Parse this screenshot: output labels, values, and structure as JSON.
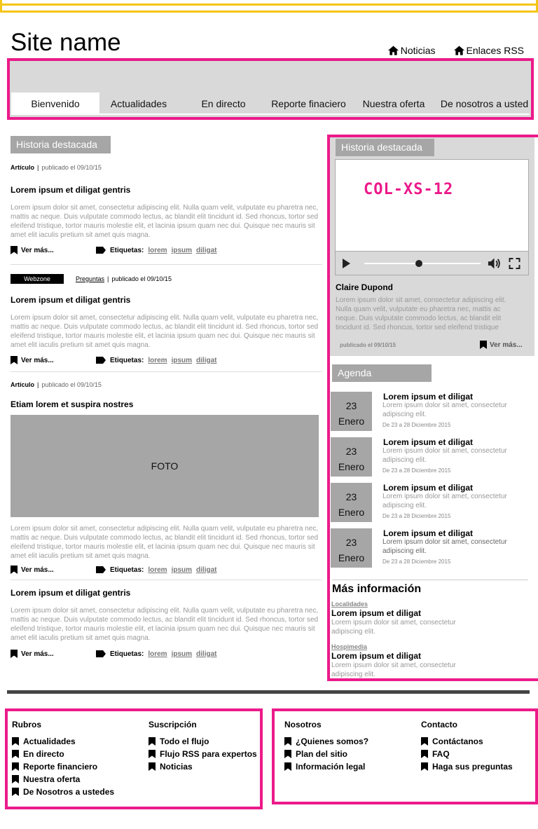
{
  "site_name": "Site name",
  "toplinks": [
    {
      "label": "Noticias",
      "icon": "home-icon"
    },
    {
      "label": "Enlaces RSS",
      "icon": "home-icon"
    }
  ],
  "tabs": [
    "Bienvenido",
    "Actualidades",
    "En directo",
    "Reporte finaciero",
    "Nuestra oferta",
    "De nosotros a usted"
  ],
  "main": {
    "section_label": "Historia destacada",
    "articles": [
      {
        "kind": "Artículo",
        "published": "publicado el 09/10/15",
        "title": "Lorem ipsum et diligat gentris",
        "text": "Lorem ipsum dolor sit amet, consectetur adipiscing elit. Nulla quam velit, vulputate eu pharetra nec, mattis ac neque. Duis vulputate commodo lectus, ac blandit elit tincidunt id. Sed rhoncus, tortor sed eleifend tristique, tortor mauris molestie elit, et lacinia ipsum quam nec dui. Quisque nec mauris sit amet elit iaculis pretium sit amet quis magna.",
        "more": "Ver más...",
        "tags_label": "Etiquetas:",
        "tags": [
          "lorem",
          "ipsum",
          "diligat"
        ]
      },
      {
        "badge": "Webzone",
        "category": "Preguntas",
        "published": "publicado el 09/10/15",
        "title": "Lorem ipsum et diligat gentris",
        "text": "Lorem ipsum dolor sit amet, consectetur adipiscing elit. Nulla quam velit, vulputate eu pharetra nec, mattis ac neque. Duis vulputate commodo lectus, ac blandit elit tincidunt id. Sed rhoncus, tortor sed eleifend tristique, tortor mauris molestie elit, et lacinia ipsum quam nec dui. Quisque nec mauris sit amet elit iaculis pretium sit amet quis magna.",
        "more": "Ver más...",
        "tags_label": "Etiquetas:",
        "tags": [
          "lorem",
          "ipsum",
          "diligat"
        ]
      },
      {
        "kind": "Artículo",
        "published": "publicado el 09/10/15",
        "title": "Etiam lorem et suspira nostres",
        "photo": "FOTO",
        "text": "Lorem ipsum dolor sit amet, consectetur adipiscing elit. Nulla quam velit, vulputate eu pharetra nec, mattis ac neque. Duis vulputate commodo lectus, ac blandit elit tincidunt id. Sed rhoncus, tortor sed eleifend tristique, tortor mauris molestie elit, et lacinia ipsum quam nec dui. Quisque nec mauris sit amet elit iaculis pretium sit amet quis magna.",
        "more": "Ver más...",
        "tags_label": "Etiquetas:",
        "tags": [
          "lorem",
          "ipsum",
          "diligat"
        ]
      },
      {
        "title": "Lorem ipsum et diligat gentris",
        "text": "Lorem ipsum dolor sit amet, consectetur adipiscing elit. Nulla quam velit, vulputate eu pharetra nec, mattis ac neque. Duis vulputate commodo lectus, ac blandit elit tincidunt id. Sed rhoncus, tortor sed eleifend tristique, tortor mauris molestie elit, et lacinia ipsum quam nec dui. Quisque nec mauris sit amet elit iaculis pretium sit amet quis magna.",
        "more": "Ver más...",
        "tags_label": "Etiquetas:",
        "tags": [
          "lorem",
          "ipsum",
          "diligat"
        ]
      }
    ]
  },
  "sidebar": {
    "featured": {
      "label": "Historia destacada",
      "video_label": "COL-XS-12",
      "progress": 0.47,
      "name": "Claire Dupond",
      "text": "Lorem ipsum dolor sit amet, consectetur adipiscing elit. Nulla quam velit, vulputate eu pharetra nec, mattis ac neque. Duis vulputate commodo lectus, ac blandit elit tincidunt id. Sed rhoncus, tortor sed eleifend tristique",
      "published": "publicado el 09/10/15",
      "more": "Ver más..."
    },
    "agenda": {
      "label": "Agenda",
      "events": [
        {
          "day": "23",
          "month": "Enero",
          "title": "Lorem ipsum et diligat",
          "text": "Lorem ipsum dolor sit amet, consectetur adipiscing elit.",
          "when": "De 23 a 28 Diciembre 2015"
        },
        {
          "day": "23",
          "month": "Enero",
          "title": "Lorem ipsum et diligat",
          "text": "Lorem ipsum dolor sit amet, consectetur adipiscing elit.",
          "when": "De 23 a 28 Diciembre 2015"
        },
        {
          "day": "23",
          "month": "Enero",
          "title": "Lorem ipsum et diligat",
          "text": "Lorem ipsum dolor sit amet, consectetur adipiscing elit.",
          "when": "De 23 a 28 Diciembre 2015"
        },
        {
          "day": "23",
          "month": "Enero",
          "title": "Lorem ipsum et diligat",
          "text": "Lorem ipsum dolor sit amet, consectetur adipiscing elit.",
          "when": "De 23 a 28 Diciembre 2015"
        }
      ]
    },
    "more_info": {
      "title": "Más información",
      "items": [
        {
          "category": "Localidades",
          "name": "Lorem ipsum et diligat",
          "text": "Lorem ipsum dolor sit amet, consectetur adipiscing elit."
        },
        {
          "category": "Hospimedia",
          "name": "Lorem ipsum et diligat",
          "text": "Lorem ipsum dolor sit amet, consectetur adipiscing elit."
        }
      ]
    }
  },
  "footer": {
    "columns": [
      {
        "title": "Rubros",
        "items": [
          "Actualidades",
          "En directo",
          "Reporte financiero",
          "Nuestra oferta",
          "De Nosotros a ustedes"
        ]
      },
      {
        "title": "Suscripción",
        "items": [
          "Todo el flujo",
          "Flujo RSS para expertos",
          "Noticias"
        ]
      },
      {
        "title": "Nosotros",
        "items": [
          "¿Quienes somos?",
          "Plan del sitio",
          "Información legal"
        ]
      },
      {
        "title": "Contacto",
        "items": [
          "Contáctanos",
          "FAQ",
          "Haga sus preguntas"
        ]
      }
    ]
  },
  "colors": {
    "accent": "#ec1a8a",
    "top_bar": "#f5c518",
    "gray_block": "#a6a6a6",
    "panel": "#d9d9d9"
  }
}
